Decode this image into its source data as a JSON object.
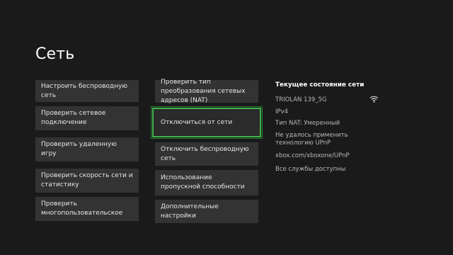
{
  "page": {
    "title": "Сеть"
  },
  "menu_left": [
    {
      "label": "Настроить беспроводную сеть"
    },
    {
      "label": "Проверить сетевое подключение"
    },
    {
      "label": "Проверить удаленную игру"
    },
    {
      "label": "Проверить скорость сети и статистику"
    },
    {
      "label": "Проверить многопользовательское"
    }
  ],
  "menu_right": [
    {
      "label": "Проверить тип преобразования сетевых адресов (NAT)"
    },
    {
      "label": "Отключиться от сети"
    },
    {
      "label": "Отключить беспроводную сеть"
    },
    {
      "label": "Использование пропускной способности"
    },
    {
      "label": "Дополнительные настройки"
    }
  ],
  "status": {
    "heading": "Текущее состояние сети",
    "network_name": "TRIOLAN 139_5G",
    "protocol": "IPv4",
    "nat_type": "Тип NAT: Умеренный",
    "upnp_error": "Не удалось применить технологию UPnP",
    "upnp_link": "xbox.com/xboxone/UPnP",
    "services": "Все службы доступны",
    "wifi_icon": "wifi-signal-icon"
  },
  "colors": {
    "background": "#1a1a1a",
    "tile": "#333333",
    "focus": "#3eb54a"
  }
}
